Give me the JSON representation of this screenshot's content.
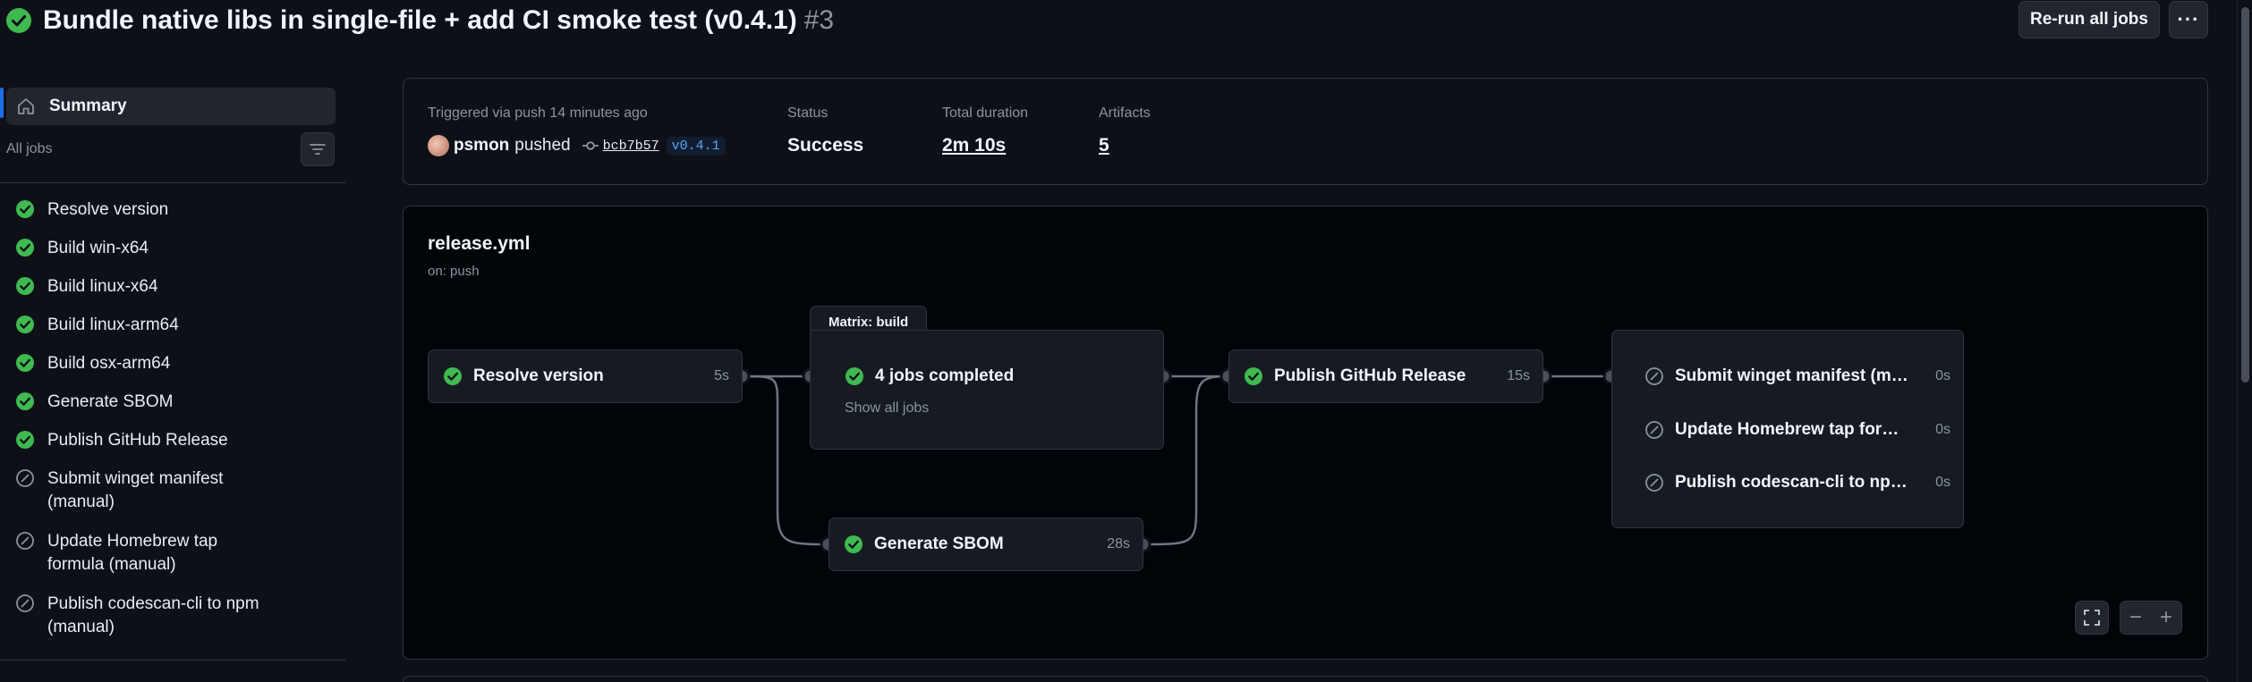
{
  "header": {
    "title": "Bundle native libs in single-file + add CI smoke test (v0.4.1)",
    "run_number": "#3",
    "rerun_label": "Re-run all jobs",
    "more_label": "···"
  },
  "sidebar": {
    "summary_label": "Summary",
    "all_jobs_label": "All jobs",
    "jobs": [
      {
        "label": "Resolve version",
        "status": "success"
      },
      {
        "label": "Build win-x64",
        "status": "success"
      },
      {
        "label": "Build linux-x64",
        "status": "success"
      },
      {
        "label": "Build linux-arm64",
        "status": "success"
      },
      {
        "label": "Build osx-arm64",
        "status": "success"
      },
      {
        "label": "Generate SBOM",
        "status": "success"
      },
      {
        "label": "Publish GitHub Release",
        "status": "success"
      },
      {
        "label": "Submit winget manifest (manual)",
        "status": "skipped"
      },
      {
        "label": "Update Homebrew tap formula (manual)",
        "status": "skipped"
      },
      {
        "label": "Publish codescan-cli to npm (manual)",
        "status": "skipped"
      }
    ]
  },
  "summary": {
    "trigger_label": "Triggered via push 14 minutes ago",
    "user": "psmon",
    "verb": "pushed",
    "commit": "bcb7b57",
    "tag": "v0.4.1",
    "status_label": "Status",
    "status_value": "Success",
    "duration_label": "Total duration",
    "duration_value": "2m 10s",
    "artifacts_label": "Artifacts",
    "artifacts_value": "5"
  },
  "graph": {
    "title": "release.yml",
    "subtitle": "on: push",
    "nodes": {
      "resolve": {
        "label": "Resolve version",
        "time": "5s"
      },
      "matrix_tab": "Matrix: build",
      "matrix": {
        "label": "4 jobs completed",
        "show_all": "Show all jobs"
      },
      "sbom": {
        "label": "Generate SBOM",
        "time": "28s"
      },
      "publish": {
        "label": "Publish GitHub Release",
        "time": "15s"
      },
      "manual": [
        {
          "label": "Submit winget manifest (manual)",
          "time": "0s"
        },
        {
          "label": "Update Homebrew tap formula (manual)",
          "time": "0s"
        },
        {
          "label": "Publish codescan-cli to npm (manual)",
          "time": "0s"
        }
      ]
    },
    "zoom_minus": "−",
    "zoom_plus": "+"
  },
  "colors": {
    "success": "#3fb950",
    "muted": "#8b949e",
    "accent": "#1f6feb",
    "link": "#58a6ff"
  }
}
